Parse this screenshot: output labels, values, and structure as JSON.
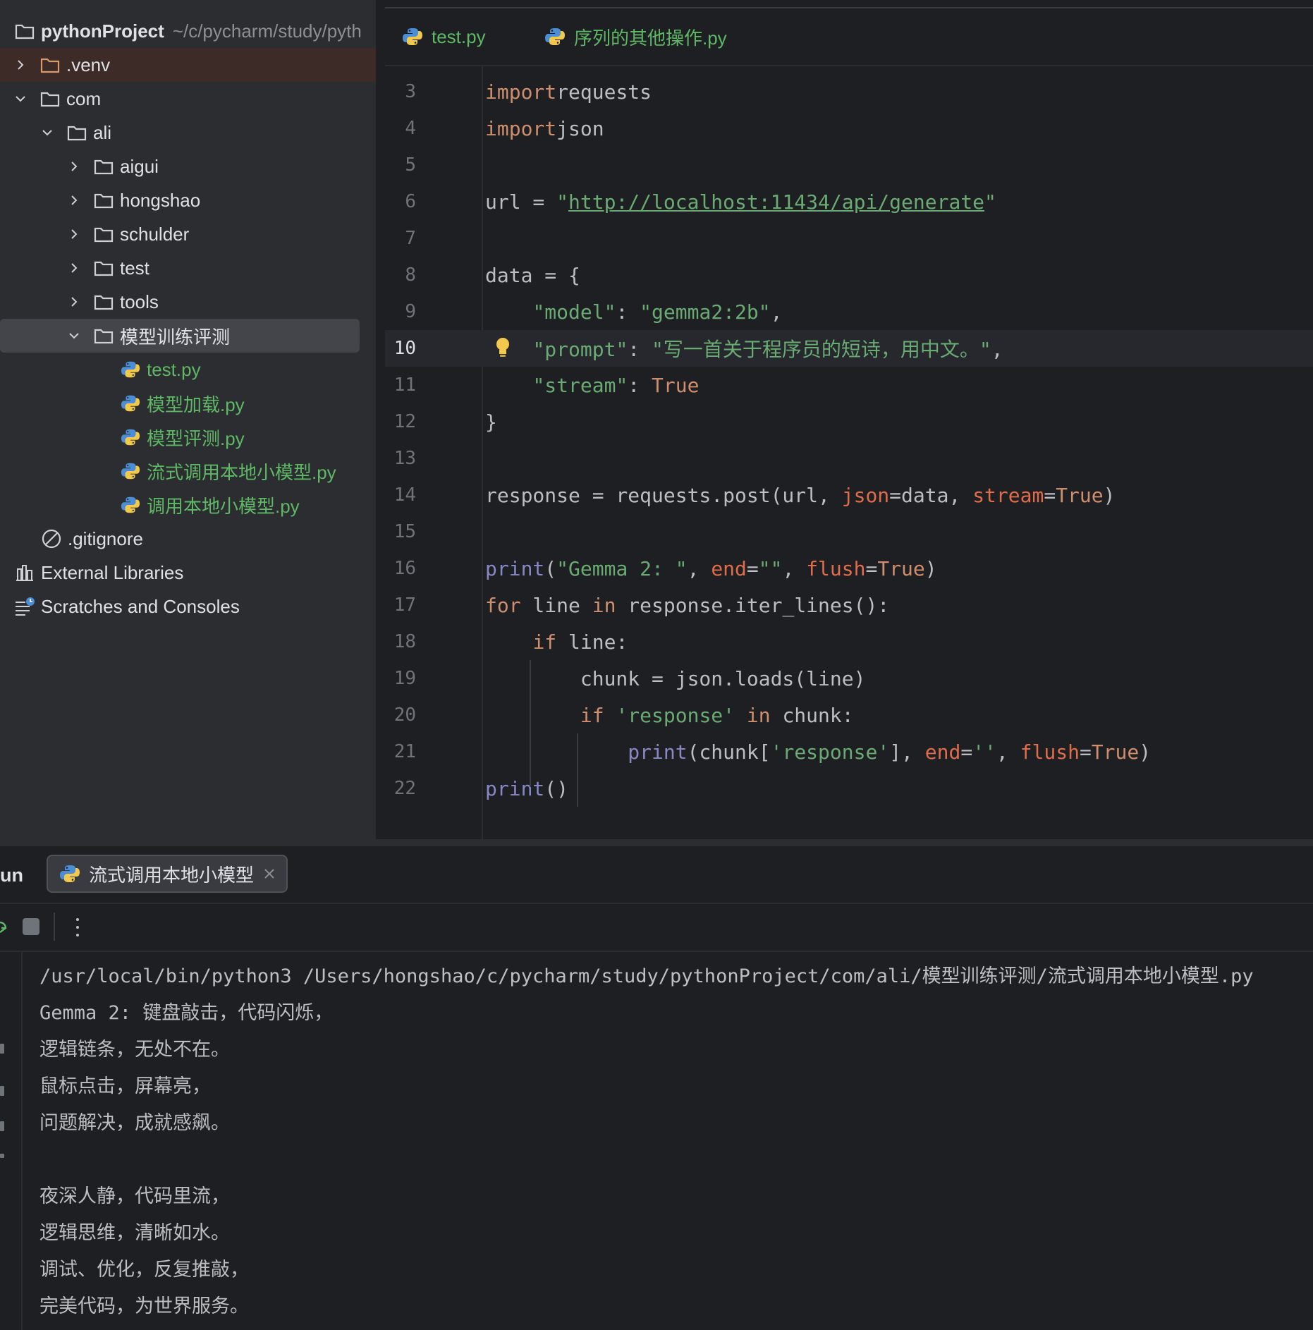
{
  "project": {
    "root_name": "pythonProject",
    "root_path": "~/c/pycharm/study/pyth",
    "tree": [
      {
        "label": ".venv",
        "kind": "folder-venv",
        "expanded": false
      },
      {
        "label": "com",
        "kind": "folder",
        "expanded": true
      },
      {
        "label": "ali",
        "kind": "folder",
        "expanded": true
      },
      {
        "label": "aigui",
        "kind": "folder",
        "expanded": false
      },
      {
        "label": "hongshao",
        "kind": "folder",
        "expanded": false
      },
      {
        "label": "schulder",
        "kind": "folder",
        "expanded": false
      },
      {
        "label": "test",
        "kind": "folder",
        "expanded": false
      },
      {
        "label": "tools",
        "kind": "folder",
        "expanded": false
      },
      {
        "label": "模型训练评测",
        "kind": "folder",
        "expanded": true,
        "selected": true
      },
      {
        "label": "test.py",
        "kind": "python-file"
      },
      {
        "label": "模型加载.py",
        "kind": "python-file"
      },
      {
        "label": "模型评测.py",
        "kind": "python-file"
      },
      {
        "label": "流式调用本地小模型.py",
        "kind": "python-file"
      },
      {
        "label": "调用本地小模型.py",
        "kind": "python-file"
      },
      {
        "label": ".gitignore",
        "kind": "ignored-file"
      },
      {
        "label": "External Libraries",
        "kind": "libraries"
      },
      {
        "label": "Scratches and Consoles",
        "kind": "scratches"
      }
    ]
  },
  "editor": {
    "tabs": [
      {
        "label": "test.py",
        "icon": "python-icon"
      },
      {
        "label": "序列的其他操作.py",
        "icon": "python-icon"
      }
    ],
    "current_line": 10,
    "lines": [
      {
        "n": "3",
        "tokens": [
          [
            "kw",
            "import"
          ],
          [
            "",
            "requests"
          ]
        ]
      },
      {
        "n": "4",
        "tokens": [
          [
            "kw",
            "import"
          ],
          [
            "",
            "json"
          ]
        ]
      },
      {
        "n": "5",
        "tokens": []
      },
      {
        "n": "6",
        "tokens": [
          [
            "",
            "url = "
          ],
          [
            "str",
            "\""
          ],
          [
            "url",
            "http://localhost:11434/api/generate"
          ],
          [
            "str",
            "\""
          ]
        ]
      },
      {
        "n": "7",
        "tokens": []
      },
      {
        "n": "8",
        "tokens": [
          [
            "",
            "data = {"
          ]
        ]
      },
      {
        "n": "9",
        "tokens": [
          [
            "",
            "    "
          ],
          [
            "str",
            "\"model\""
          ],
          [
            "",
            ": "
          ],
          [
            "str",
            "\"gemma2:2b\""
          ],
          [
            "",
            ","
          ]
        ]
      },
      {
        "n": "10",
        "tokens": [
          [
            "",
            "    "
          ],
          [
            "str",
            "\"prompt\""
          ],
          [
            "",
            ": "
          ],
          [
            "str",
            "\"写一首关于程序员的短诗，用中文。\""
          ],
          [
            "",
            ","
          ]
        ]
      },
      {
        "n": "11",
        "tokens": [
          [
            "",
            "    "
          ],
          [
            "str",
            "\"stream\""
          ],
          [
            "",
            ": "
          ],
          [
            "kw",
            "True"
          ]
        ]
      },
      {
        "n": "12",
        "tokens": [
          [
            "",
            "}"
          ]
        ]
      },
      {
        "n": "13",
        "tokens": []
      },
      {
        "n": "14",
        "tokens": [
          [
            "",
            "response = requests.post(url, "
          ],
          [
            "prm",
            "json"
          ],
          [
            "",
            "=data, "
          ],
          [
            "prm",
            "stream"
          ],
          [
            "",
            "="
          ],
          [
            "kw",
            "True"
          ],
          [
            "",
            ")"
          ]
        ]
      },
      {
        "n": "15",
        "tokens": []
      },
      {
        "n": "16",
        "tokens": [
          [
            "bi",
            "print"
          ],
          [
            "",
            "("
          ],
          [
            "str",
            "\"Gemma 2: \""
          ],
          [
            "",
            ", "
          ],
          [
            "prm",
            "end"
          ],
          [
            "",
            "="
          ],
          [
            "str",
            "\"\""
          ],
          [
            "",
            ", "
          ],
          [
            "prm",
            "flush"
          ],
          [
            "",
            "="
          ],
          [
            "kw",
            "True"
          ],
          [
            "",
            ")"
          ]
        ]
      },
      {
        "n": "17",
        "tokens": [
          [
            "kw",
            "for"
          ],
          [
            "",
            " line "
          ],
          [
            "kw",
            "in"
          ],
          [
            "",
            " response.iter_lines():"
          ]
        ]
      },
      {
        "n": "18",
        "tokens": [
          [
            "",
            "    "
          ],
          [
            "kw",
            "if"
          ],
          [
            "",
            " line:"
          ]
        ]
      },
      {
        "n": "19",
        "tokens": [
          [
            "",
            "        chunk = json.loads(line)"
          ]
        ]
      },
      {
        "n": "20",
        "tokens": [
          [
            "",
            "        "
          ],
          [
            "kw",
            "if"
          ],
          [
            "",
            " "
          ],
          [
            "str",
            "'response'"
          ],
          [
            "",
            " "
          ],
          [
            "kw",
            "in"
          ],
          [
            "",
            " chunk:"
          ]
        ]
      },
      {
        "n": "21",
        "tokens": [
          [
            "",
            "            "
          ],
          [
            "bi",
            "print"
          ],
          [
            "",
            "(chunk["
          ],
          [
            "str",
            "'response'"
          ],
          [
            "",
            "], "
          ],
          [
            "prm",
            "end"
          ],
          [
            "",
            "="
          ],
          [
            "str",
            "''"
          ],
          [
            "",
            ", "
          ],
          [
            "prm",
            "flush"
          ],
          [
            "",
            "="
          ],
          [
            "kw",
            "True"
          ],
          [
            "",
            ")"
          ]
        ]
      },
      {
        "n": "22",
        "tokens": [
          [
            "bi",
            "print"
          ],
          [
            "",
            "()"
          ]
        ]
      }
    ]
  },
  "run": {
    "label": "un",
    "tab_label": "流式调用本地小模型",
    "output": [
      "/usr/local/bin/python3 /Users/hongshao/c/pycharm/study/pythonProject/com/ali/模型训练评测/流式调用本地小模型.py",
      "Gemma 2: 键盘敲击，代码闪烁，",
      "逻辑链条，无处不在。",
      "鼠标点击，屏幕亮，",
      "问题解决，成就感飙。",
      "",
      "夜深人静，代码里流，",
      "逻辑思维，清晰如水。",
      "调试、优化，反复推敲，",
      "完美代码，为世界服务。"
    ]
  },
  "colors": {
    "background": "#1e1f22",
    "sidebar": "#2b2d30",
    "keyword": "#cf8e6d",
    "string": "#6aab73",
    "builtin": "#8888c6",
    "param": "#e06c4a",
    "python_file": "#5fb865"
  }
}
